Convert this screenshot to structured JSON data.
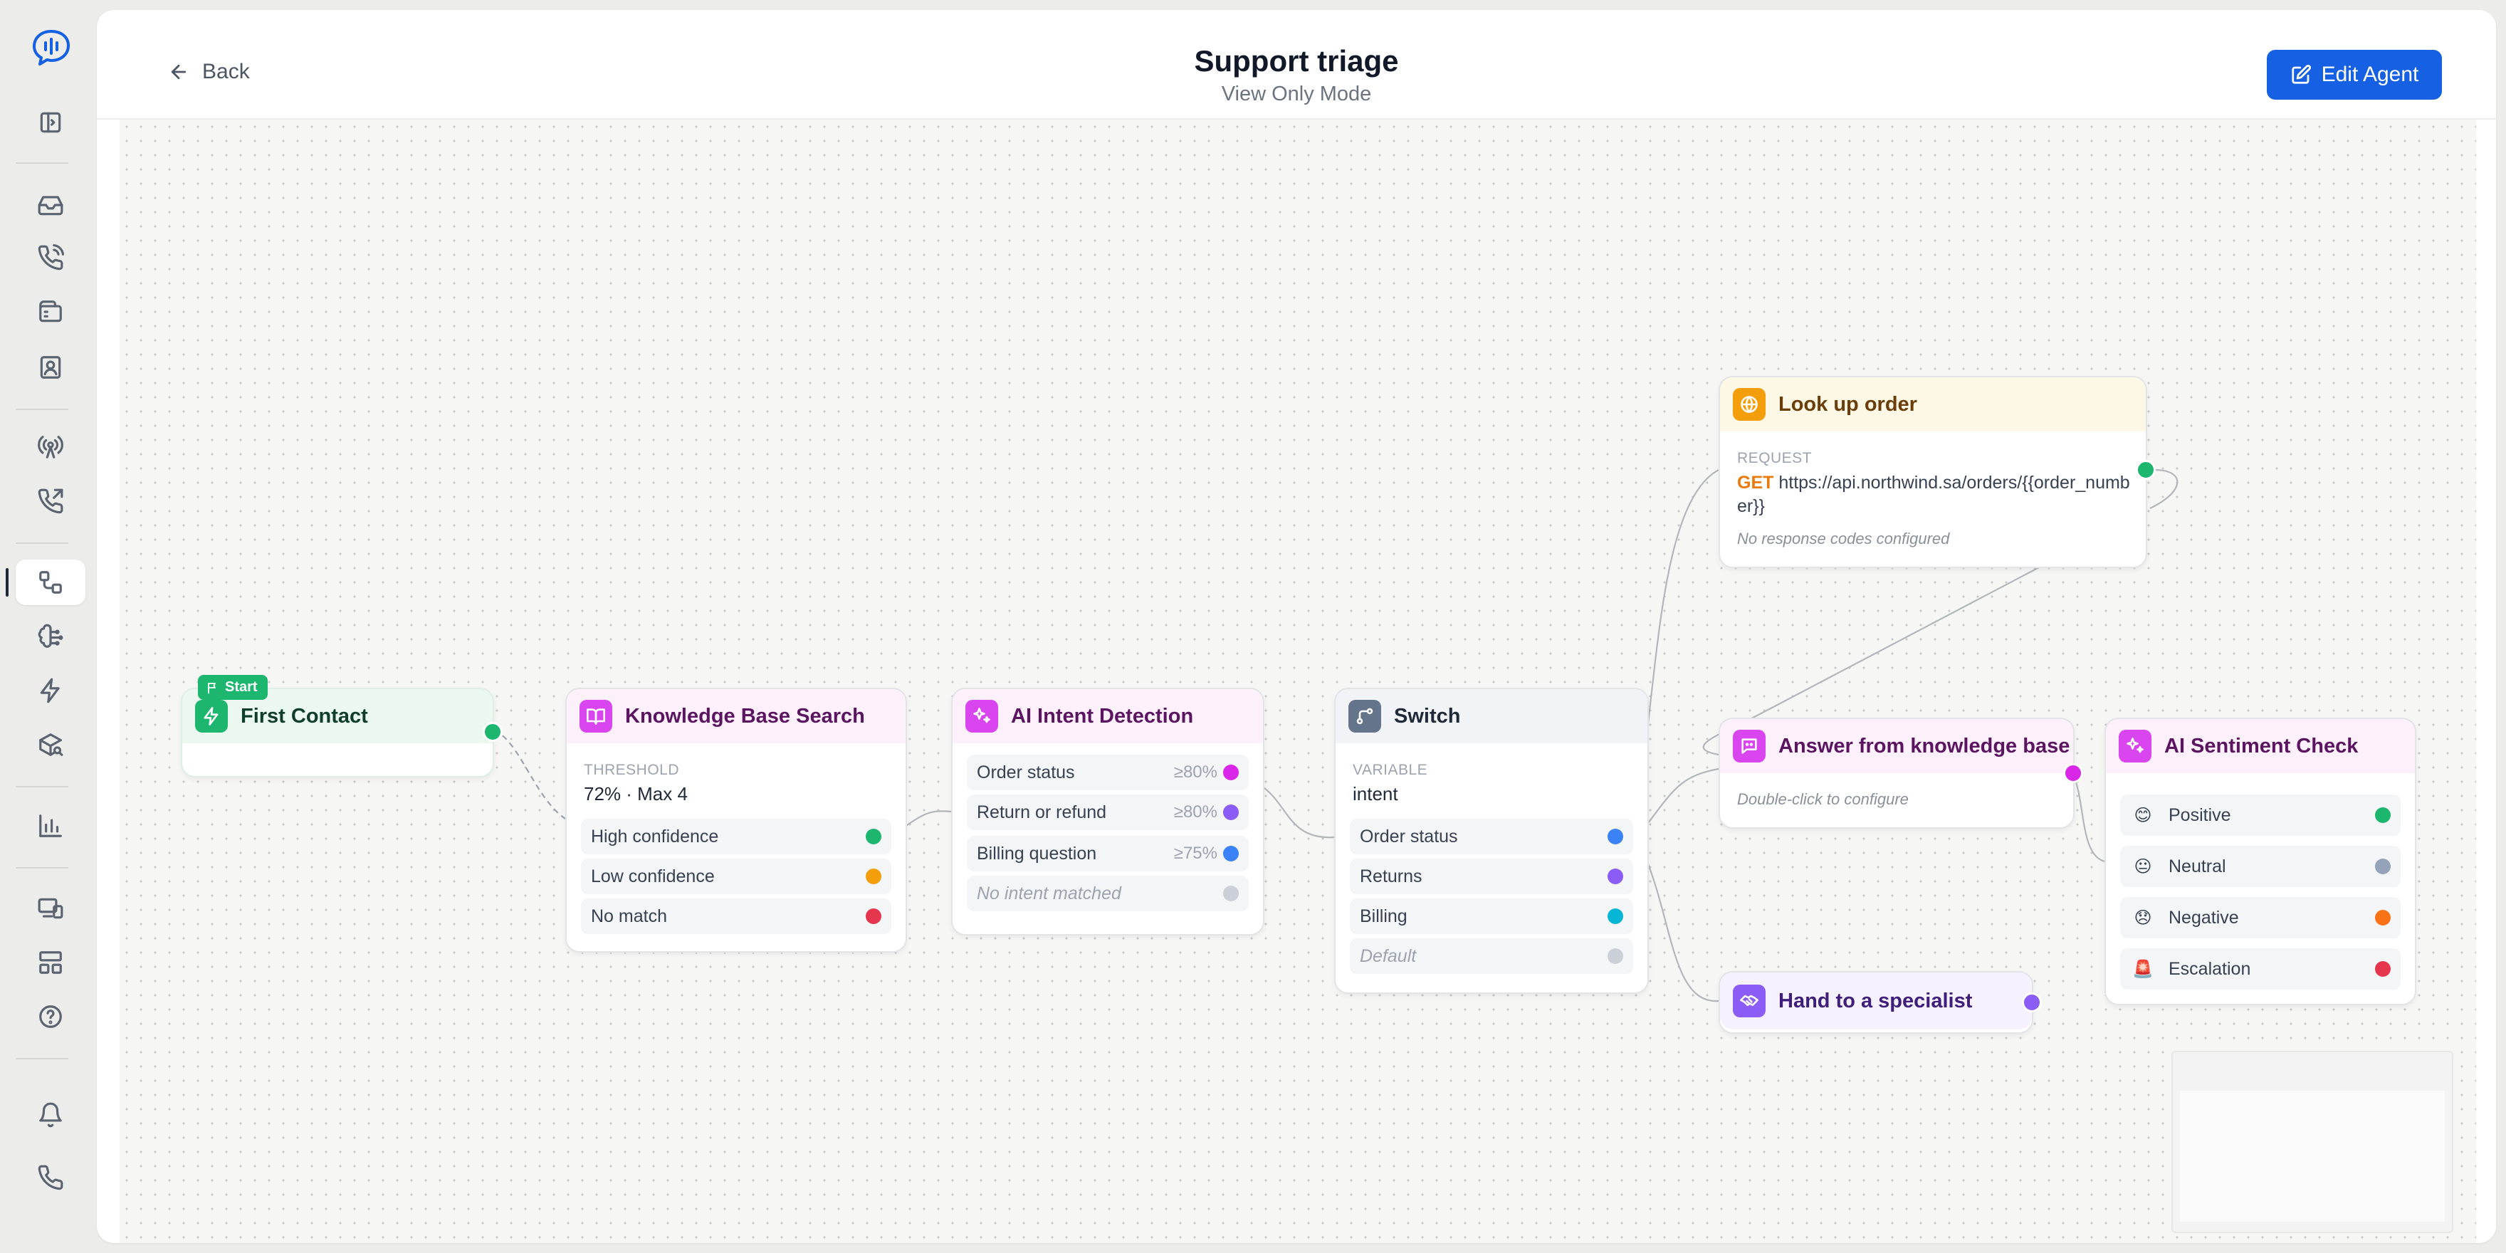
{
  "header": {
    "back_label": "Back",
    "title": "Support triage",
    "subtitle": "View Only Mode",
    "edit_label": "Edit Agent"
  },
  "colors": {
    "primary": "#1560e3",
    "start_green": "#1db66e",
    "kb_pink": "#d946ef",
    "intent_magenta": "#d946ef",
    "switch_slate": "#64748b",
    "api_orange": "#f59e0b",
    "handoff_violet": "#8b5cf6"
  },
  "rail": {
    "items": [
      "logo-icon",
      "sidebar-toggle-icon",
      "inbox-icon",
      "phone-call-icon",
      "wallet-icon",
      "contacts-icon",
      "broadcast-icon",
      "outbound-call-icon",
      "flows-icon",
      "knowledge-icon",
      "automations-icon",
      "integrations-icon",
      "analytics-icon",
      "devices-icon",
      "layout-icon",
      "help-icon",
      "bell-icon",
      "phone-icon"
    ]
  },
  "nodes": {
    "start": {
      "badge": "Start",
      "title": "First Contact"
    },
    "kb": {
      "title": "Knowledge Base Search",
      "threshold_label": "THRESHOLD",
      "threshold_value": "72% · Max 4",
      "outputs": [
        "High confidence",
        "Low confidence",
        "No match"
      ]
    },
    "intent": {
      "title": "AI Intent Detection",
      "outputs": [
        {
          "label": "Order status",
          "pct": "≥80%"
        },
        {
          "label": "Return or refund",
          "pct": "≥80%"
        },
        {
          "label": "Billing question",
          "pct": "≥75%"
        }
      ],
      "fallback": "No intent matched"
    },
    "switch": {
      "title": "Switch",
      "variable_label": "VARIABLE",
      "variable_value": "intent",
      "outputs": [
        "Order status",
        "Returns",
        "Billing"
      ],
      "default": "Default"
    },
    "lookup": {
      "title": "Look up order",
      "request_label": "REQUEST",
      "method": "GET",
      "url": "https://api.northwind.sa/orders/{{order_number}}",
      "note": "No response codes configured"
    },
    "answer": {
      "title": "Answer from knowledge base",
      "note": "Double-click to configure"
    },
    "handoff": {
      "title": "Hand to a specialist"
    },
    "sentiment": {
      "title": "AI Sentiment Check",
      "outputs": [
        {
          "label": "Positive",
          "emoji": "😊"
        },
        {
          "label": "Neutral",
          "emoji": "😐"
        },
        {
          "label": "Negative",
          "emoji": "😞"
        },
        {
          "label": "Escalation",
          "emoji": "🚨"
        }
      ]
    }
  }
}
